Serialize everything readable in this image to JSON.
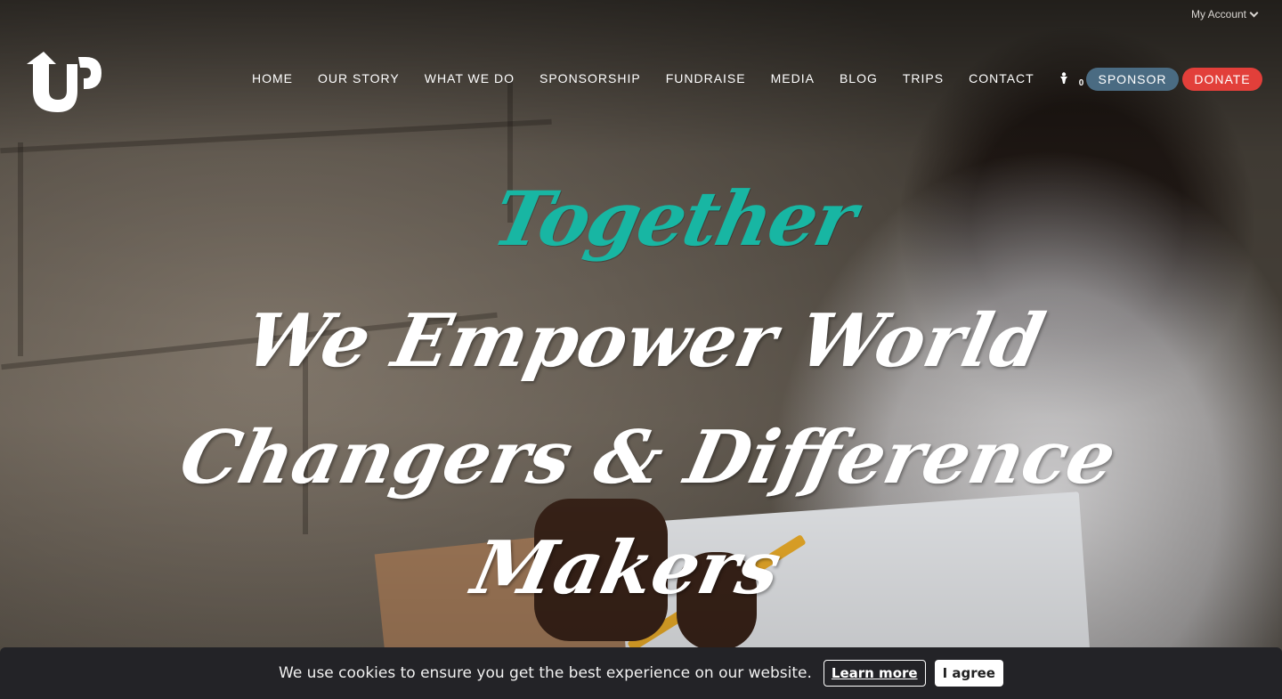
{
  "header": {
    "account_label": "My Account",
    "logo_alt": "UP",
    "nav": [
      {
        "label": "HOME"
      },
      {
        "label": "OUR STORY"
      },
      {
        "label": "WHAT WE DO"
      },
      {
        "label": "SPONSORSHIP"
      },
      {
        "label": "FUNDRAISE"
      },
      {
        "label": "MEDIA"
      },
      {
        "label": "BLOG"
      },
      {
        "label": "TRIPS"
      },
      {
        "label": "CONTACT"
      }
    ],
    "cart_count": "0",
    "sponsor_label": "SPONSOR",
    "donate_label": "DONATE"
  },
  "hero": {
    "accent_word": "Together",
    "line1": "We Empower World",
    "line2": "Changers & Difference",
    "line3": "Makers"
  },
  "cookie_bar": {
    "message": "We use cookies to ensure you get the best experience on our website.",
    "learn_more": "Learn more",
    "agree": "I agree"
  },
  "colors": {
    "accent": "#18b6a3",
    "sponsor_button": "#4a6b82",
    "donate_button": "#e23f3a",
    "cookie_bg": "#232327"
  }
}
